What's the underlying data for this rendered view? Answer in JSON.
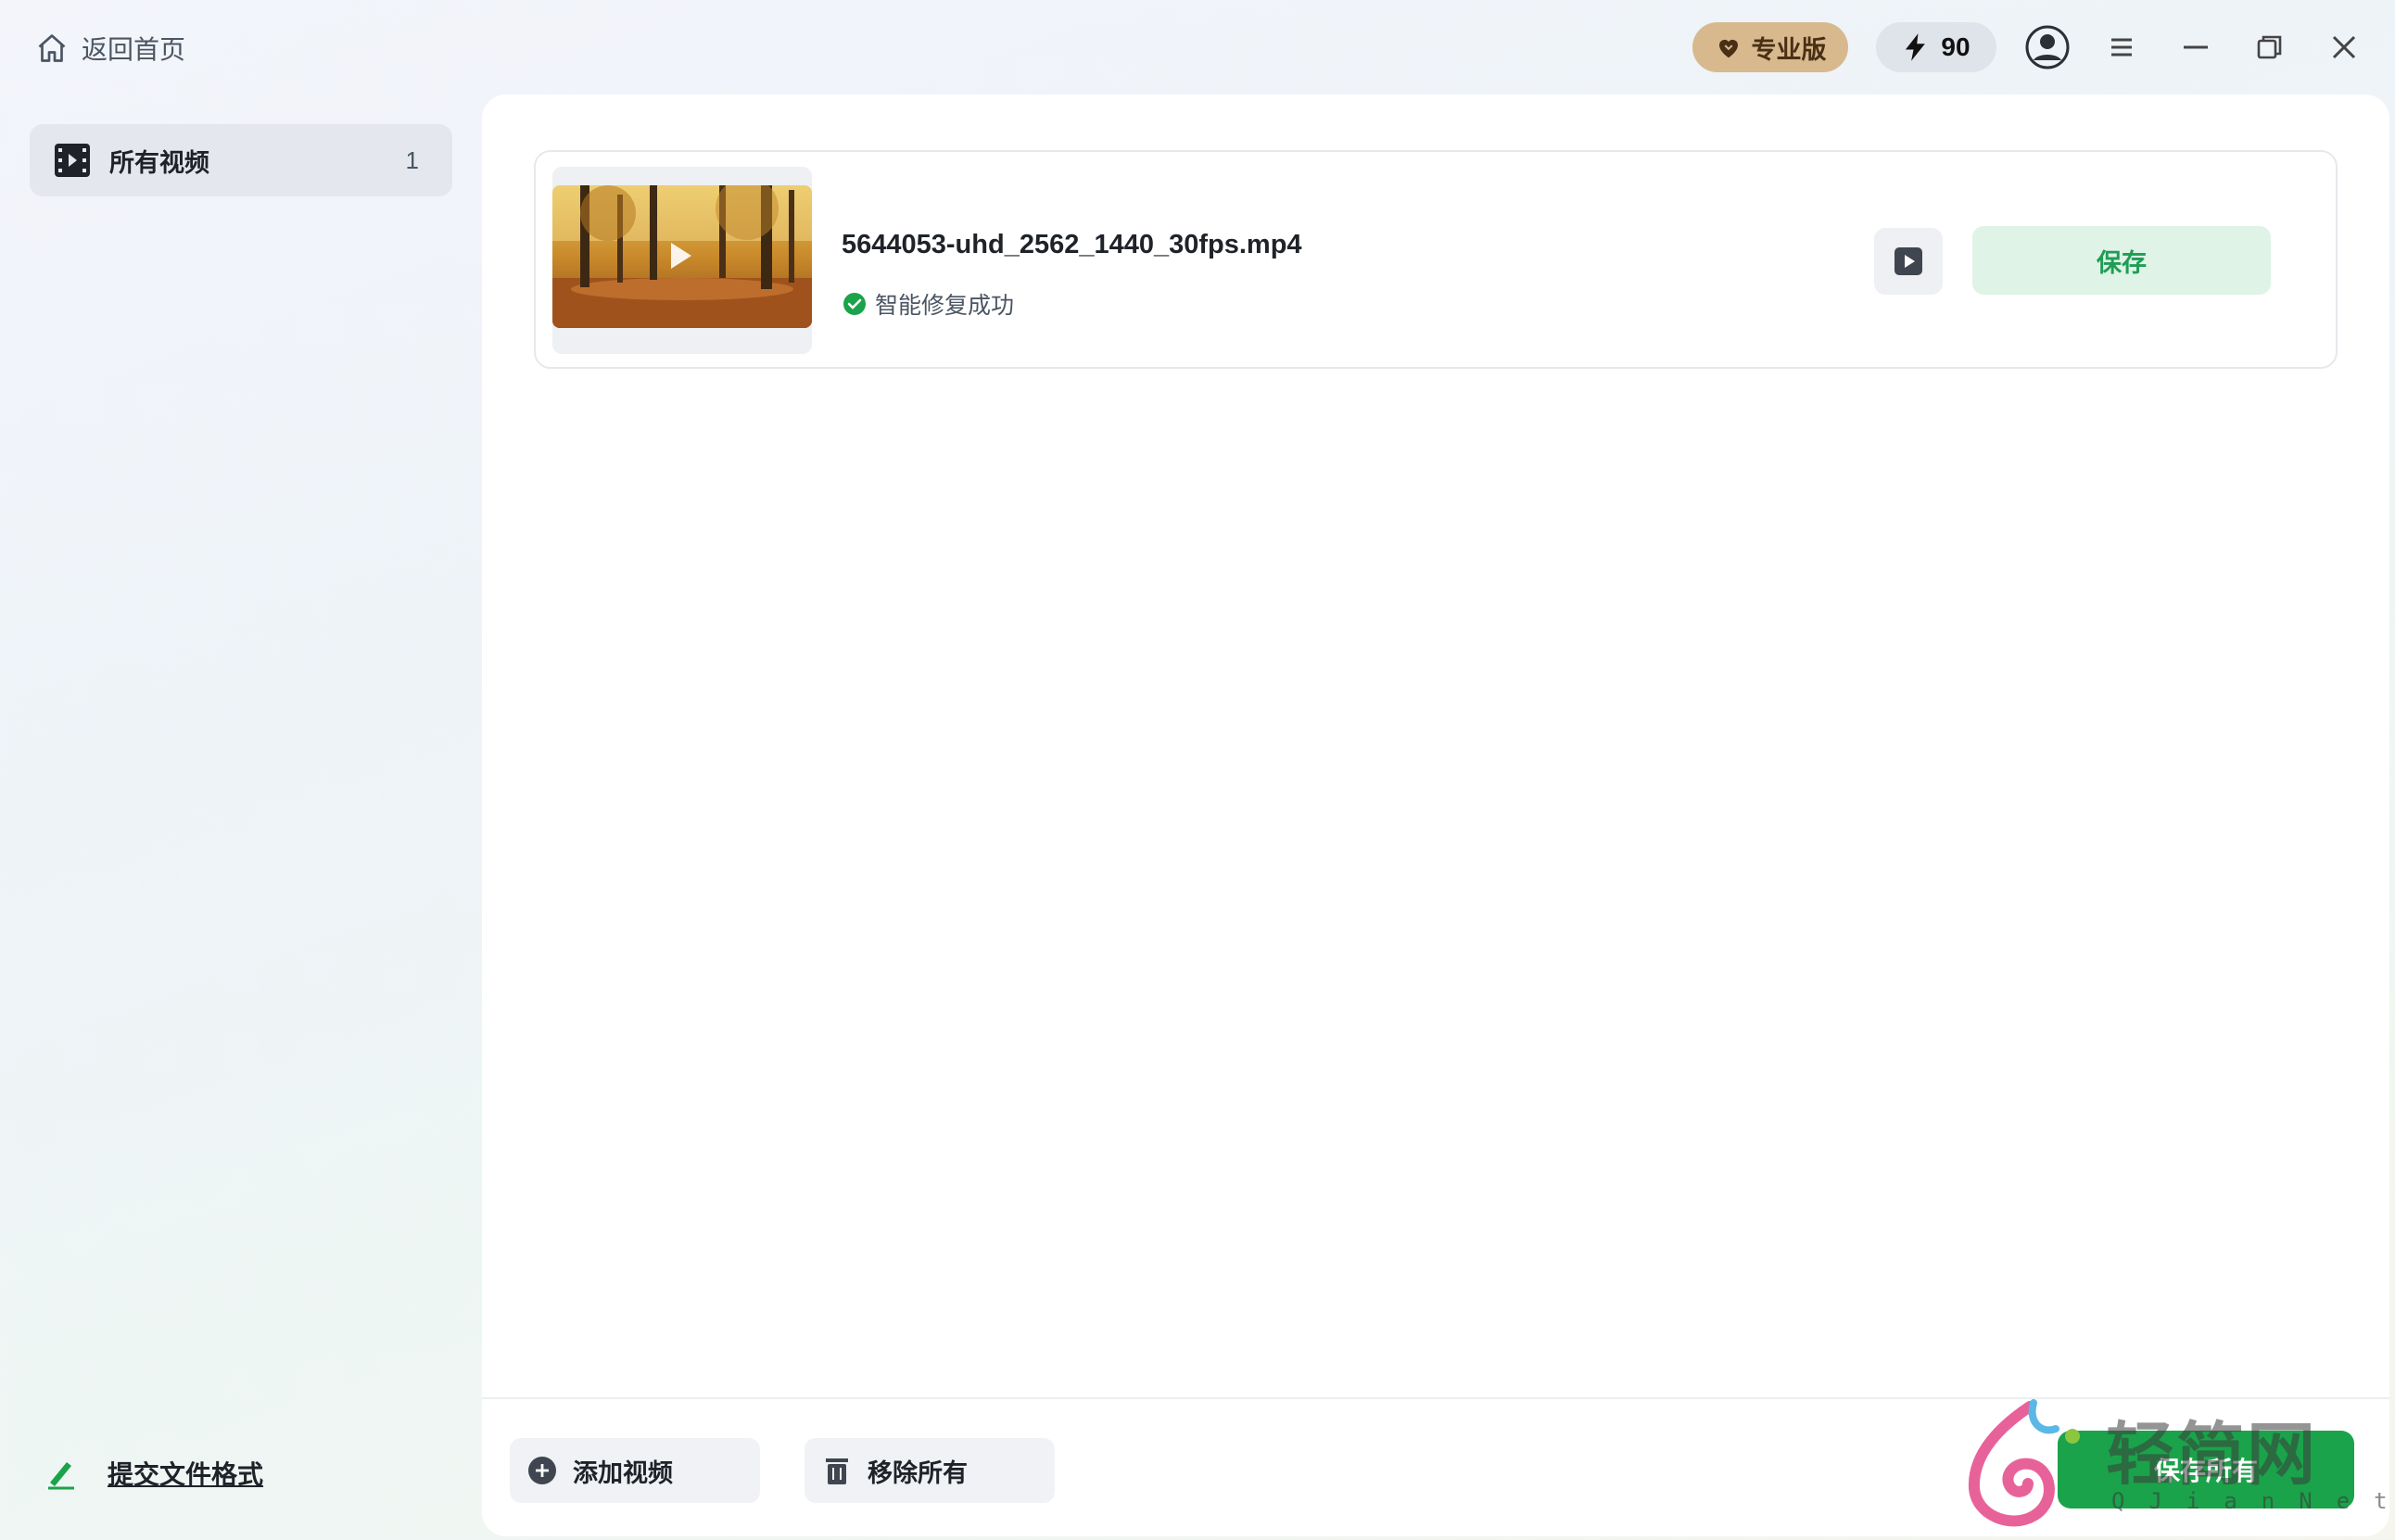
{
  "titlebar": {
    "home_label": "返回首页",
    "pro_label": "专业版",
    "credits": "90"
  },
  "sidebar": {
    "items": [
      {
        "label": "所有视频",
        "count": "1"
      }
    ],
    "submit_format_label": "提交文件格式"
  },
  "videos": [
    {
      "filename": "5644053-uhd_2562_1440_30fps.mp4",
      "status": "智能修复成功",
      "save_label": "保存"
    }
  ],
  "bottom_bar": {
    "add_video_label": "添加视频",
    "remove_all_label": "移除所有",
    "save_all_label": "保存所有"
  },
  "watermark": {
    "text": "轻简网",
    "subtext": "QJianNet"
  },
  "icons": {
    "home": "home-icon",
    "pro": "heart-icon",
    "credits": "lightning-icon",
    "user": "user-icon",
    "menu": "hamburger-icon",
    "minimize": "minimize-icon",
    "restore": "restore-icon",
    "close": "close-icon",
    "video": "film-icon",
    "edit": "pen-icon",
    "check": "check-circle-icon",
    "play": "play-icon",
    "add": "plus-circle-icon",
    "trash": "trash-icon"
  },
  "colors": {
    "accent_green": "#1aa34a",
    "save_bg": "#dff3e6",
    "pro_gold": "#d7b98d"
  }
}
